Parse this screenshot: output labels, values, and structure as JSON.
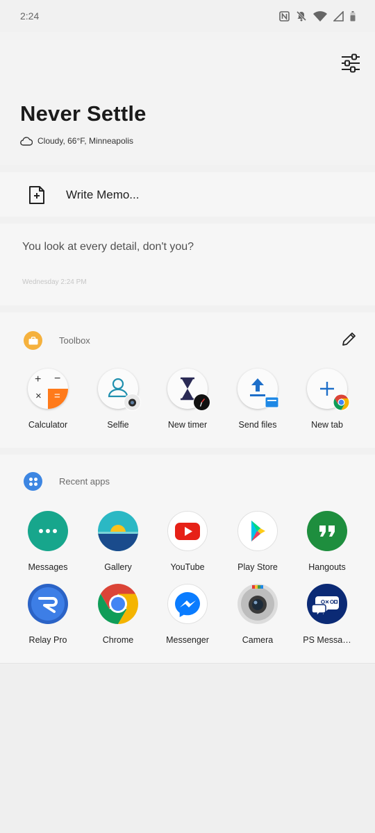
{
  "status_bar": {
    "time": "2:24"
  },
  "header": {
    "title": "Never Settle",
    "weather": "Cloudy, 66°F, Minneapolis"
  },
  "memo": {
    "label": "Write Memo..."
  },
  "quote": {
    "text": "You look at every detail, don't you?",
    "timestamp": "Wednesday 2:24 PM"
  },
  "toolbox": {
    "title": "Toolbox",
    "items": [
      {
        "label": "Calculator",
        "icon": "calculator-icon"
      },
      {
        "label": "Selfie",
        "icon": "selfie-icon"
      },
      {
        "label": "New timer",
        "icon": "timer-icon"
      },
      {
        "label": "Send files",
        "icon": "send-files-icon"
      },
      {
        "label": "New tab",
        "icon": "new-tab-icon"
      }
    ]
  },
  "recent_apps": {
    "title": "Recent apps",
    "items": [
      {
        "label": "Messages",
        "icon": "messages-icon"
      },
      {
        "label": "Gallery",
        "icon": "gallery-icon"
      },
      {
        "label": "YouTube",
        "icon": "youtube-icon"
      },
      {
        "label": "Play Store",
        "icon": "play-store-icon"
      },
      {
        "label": "Hangouts",
        "icon": "hangouts-icon"
      },
      {
        "label": "Relay Pro",
        "icon": "relay-pro-icon"
      },
      {
        "label": "Chrome",
        "icon": "chrome-icon"
      },
      {
        "label": "Messenger",
        "icon": "messenger-icon"
      },
      {
        "label": "Camera",
        "icon": "camera-icon"
      },
      {
        "label": "PS Messa…",
        "icon": "ps-messages-icon"
      }
    ]
  },
  "colors": {
    "toolbox_badge": "#f5b13d",
    "recent_badge": "#3d86e2",
    "calculator_orange": "#ff7a1a",
    "youtube_red": "#e62117",
    "hangouts_green": "#1e8e3e",
    "messages_teal": "#17a68c"
  }
}
